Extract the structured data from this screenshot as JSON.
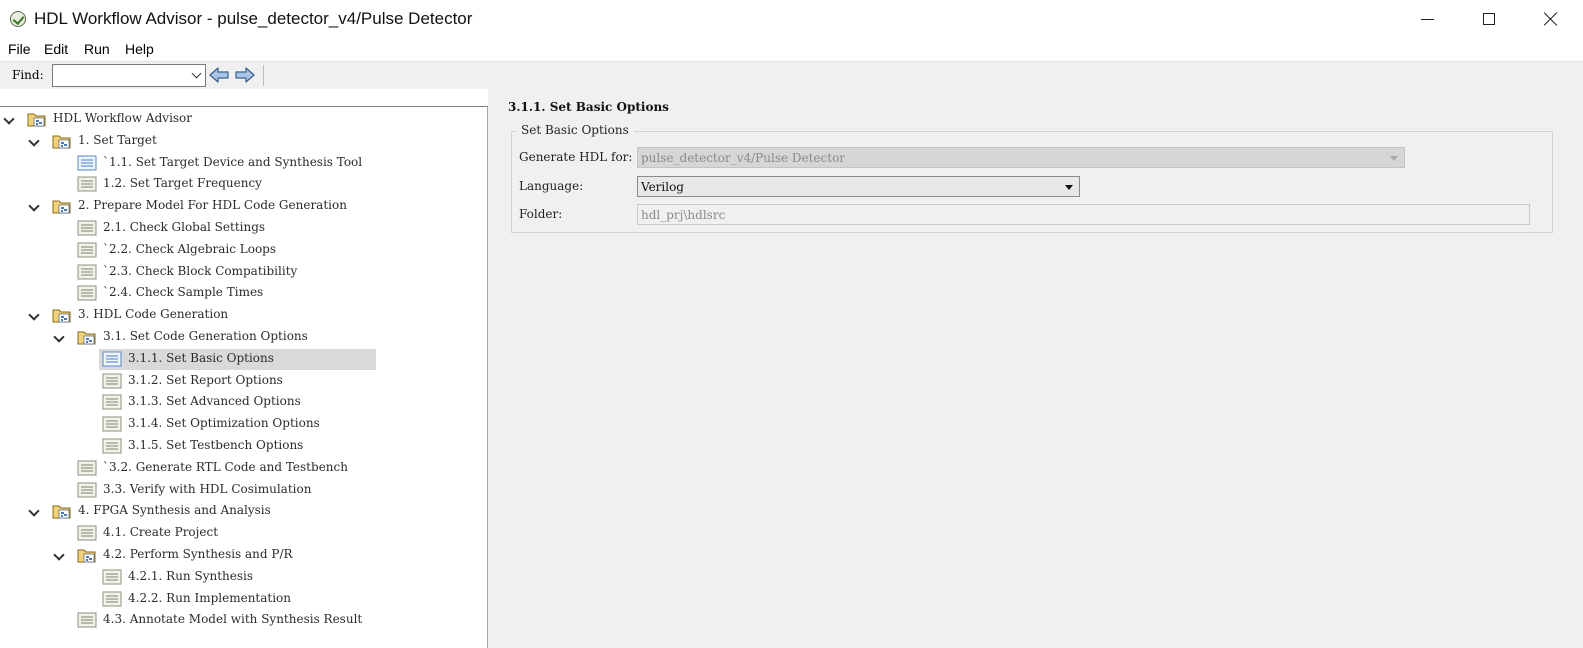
{
  "window": {
    "title": "HDL Workflow Advisor - pulse_detector_v4/Pulse Detector"
  },
  "menu": [
    "File",
    "Edit",
    "Run",
    "Help"
  ],
  "toolbar": {
    "find_label": "Find:",
    "find_value": ""
  },
  "tree": [
    {
      "level": 0,
      "label": "HDL Workflow Advisor",
      "type": "folder",
      "expanded": true
    },
    {
      "level": 1,
      "label": "1. Set Target",
      "type": "folder",
      "expanded": true
    },
    {
      "level": 2,
      "label": "`1.1. Set Target Device and Synthesis Tool",
      "type": "task-blue"
    },
    {
      "level": 2,
      "label": "1.2. Set Target Frequency",
      "type": "task"
    },
    {
      "level": 1,
      "label": "2. Prepare Model For HDL Code Generation",
      "type": "folder",
      "expanded": true
    },
    {
      "level": 2,
      "label": "2.1. Check Global Settings",
      "type": "task"
    },
    {
      "level": 2,
      "label": "`2.2. Check Algebraic Loops",
      "type": "task"
    },
    {
      "level": 2,
      "label": "`2.3. Check Block Compatibility",
      "type": "task"
    },
    {
      "level": 2,
      "label": "`2.4. Check Sample Times",
      "type": "task"
    },
    {
      "level": 1,
      "label": "3. HDL Code Generation",
      "type": "folder",
      "expanded": true
    },
    {
      "level": 2,
      "label": "3.1. Set Code Generation Options",
      "type": "folder",
      "expanded": true
    },
    {
      "level": 3,
      "label": "3.1.1. Set Basic Options",
      "type": "task-blue",
      "selected": true
    },
    {
      "level": 3,
      "label": "3.1.2. Set Report Options",
      "type": "task"
    },
    {
      "level": 3,
      "label": "3.1.3. Set Advanced Options",
      "type": "task"
    },
    {
      "level": 3,
      "label": "3.1.4. Set Optimization Options",
      "type": "task"
    },
    {
      "level": 3,
      "label": "3.1.5. Set Testbench Options",
      "type": "task"
    },
    {
      "level": 2,
      "label": "`3.2. Generate RTL Code and Testbench",
      "type": "task"
    },
    {
      "level": 2,
      "label": "3.3. Verify with HDL Cosimulation",
      "type": "task"
    },
    {
      "level": 1,
      "label": "4. FPGA Synthesis and Analysis",
      "type": "folder",
      "expanded": true
    },
    {
      "level": 2,
      "label": "4.1. Create Project",
      "type": "task"
    },
    {
      "level": 2,
      "label": "4.2. Perform Synthesis and P/R",
      "type": "folder",
      "expanded": true
    },
    {
      "level": 3,
      "label": "4.2.1. Run Synthesis",
      "type": "task"
    },
    {
      "level": 3,
      "label": "4.2.2. Run Implementation",
      "type": "task"
    },
    {
      "level": 2,
      "label": "4.3. Annotate Model with Synthesis Result",
      "type": "task"
    }
  ],
  "panel": {
    "title": "3.1.1. Set Basic Options",
    "group_title": "Set Basic Options",
    "generate_label": "Generate HDL for:",
    "generate_value": "pulse_detector_v4/Pulse Detector",
    "language_label": "Language:",
    "language_value": "Verilog",
    "folder_label": "Folder:",
    "folder_value": "hdl_prj\\hdlsrc"
  }
}
